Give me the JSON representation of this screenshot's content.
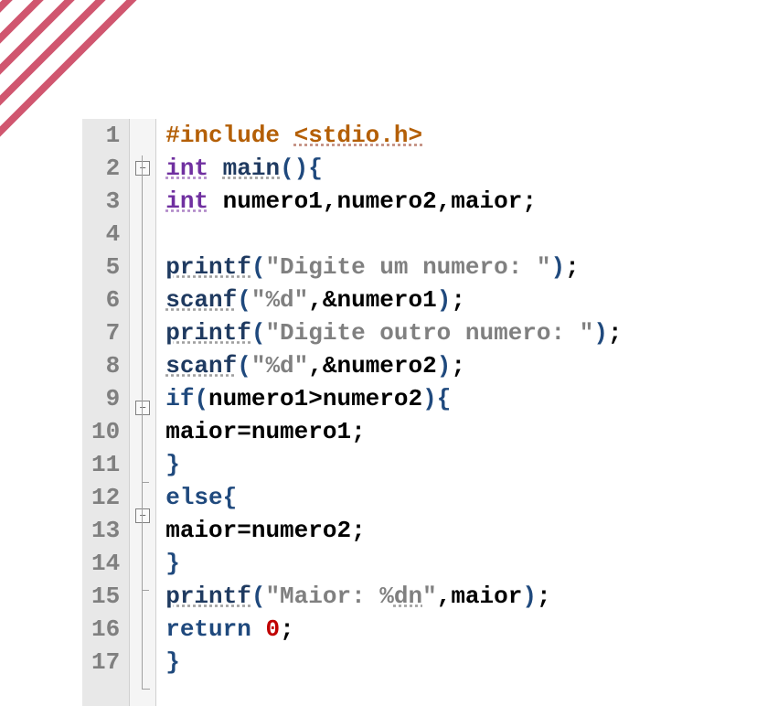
{
  "lines": [
    {
      "n": "1",
      "tokens": [
        [
          "tok-prep",
          "#include "
        ],
        [
          "tok-inc",
          "<stdio.h>"
        ]
      ]
    },
    {
      "n": "2",
      "tokens": [
        [
          "tok-type",
          "int"
        ],
        [
          "tok-punc",
          " "
        ],
        [
          "tok-fn",
          "main"
        ],
        [
          "tok-brace",
          "()"
        ],
        [
          "tok-brace",
          "{"
        ]
      ]
    },
    {
      "n": "3",
      "tokens": [
        [
          "tok-type",
          "int"
        ],
        [
          "tok-punc",
          " "
        ],
        [
          "tok-id",
          "numero1"
        ],
        [
          "tok-punc",
          ","
        ],
        [
          "tok-id",
          "numero2"
        ],
        [
          "tok-punc",
          ","
        ],
        [
          "tok-id",
          "maior"
        ],
        [
          "tok-punc",
          ";"
        ]
      ]
    },
    {
      "n": "4",
      "tokens": []
    },
    {
      "n": "5",
      "tokens": [
        [
          "tok-fn",
          "printf"
        ],
        [
          "tok-brace",
          "("
        ],
        [
          "tok-str",
          "\"Digite um numero: \""
        ],
        [
          "tok-brace",
          ")"
        ],
        [
          "tok-punc",
          ";"
        ]
      ]
    },
    {
      "n": "6",
      "tokens": [
        [
          "tok-fn",
          "scanf"
        ],
        [
          "tok-brace",
          "("
        ],
        [
          "tok-str",
          "\"%d\""
        ],
        [
          "tok-punc",
          ","
        ],
        [
          "tok-punc",
          "&"
        ],
        [
          "tok-id",
          "numero1"
        ],
        [
          "tok-brace",
          ")"
        ],
        [
          "tok-punc",
          ";"
        ]
      ]
    },
    {
      "n": "7",
      "tokens": [
        [
          "tok-fn",
          "printf"
        ],
        [
          "tok-brace",
          "("
        ],
        [
          "tok-str",
          "\"Digite outro numero: \""
        ],
        [
          "tok-brace",
          ")"
        ],
        [
          "tok-punc",
          ";"
        ]
      ]
    },
    {
      "n": "8",
      "tokens": [
        [
          "tok-fn",
          "scanf"
        ],
        [
          "tok-brace",
          "("
        ],
        [
          "tok-str",
          "\"%d\""
        ],
        [
          "tok-punc",
          ","
        ],
        [
          "tok-punc",
          "&"
        ],
        [
          "tok-id",
          "numero2"
        ],
        [
          "tok-brace",
          ")"
        ],
        [
          "tok-punc",
          ";"
        ]
      ]
    },
    {
      "n": "9",
      "tokens": [
        [
          "tok-kw",
          "if"
        ],
        [
          "tok-brace",
          "("
        ],
        [
          "tok-id",
          "numero1"
        ],
        [
          "tok-punc",
          ">"
        ],
        [
          "tok-id",
          "numero2"
        ],
        [
          "tok-brace",
          ")"
        ],
        [
          "tok-brace",
          "{"
        ]
      ]
    },
    {
      "n": "10",
      "tokens": [
        [
          "tok-id",
          "maior"
        ],
        [
          "tok-punc",
          "="
        ],
        [
          "tok-id",
          "numero1"
        ],
        [
          "tok-punc",
          ";"
        ]
      ]
    },
    {
      "n": "11",
      "tokens": [
        [
          "tok-brace",
          "}"
        ]
      ]
    },
    {
      "n": "12",
      "tokens": [
        [
          "tok-kw",
          "else"
        ],
        [
          "tok-brace",
          "{"
        ]
      ]
    },
    {
      "n": "13",
      "tokens": [
        [
          "tok-id",
          "maior"
        ],
        [
          "tok-punc",
          "="
        ],
        [
          "tok-id",
          "numero2"
        ],
        [
          "tok-punc",
          ";"
        ]
      ]
    },
    {
      "n": "14",
      "tokens": [
        [
          "tok-brace",
          "}"
        ]
      ]
    },
    {
      "n": "15",
      "tokens": [
        [
          "tok-fn",
          "printf"
        ],
        [
          "tok-brace",
          "("
        ],
        [
          "tok-str",
          "\"Maior: %"
        ],
        [
          "tok-str tok-strU",
          "dn"
        ],
        [
          "tok-str",
          "\""
        ],
        [
          "tok-punc",
          ","
        ],
        [
          "tok-id",
          "maior"
        ],
        [
          "tok-brace",
          ")"
        ],
        [
          "tok-punc",
          ";"
        ]
      ]
    },
    {
      "n": "16",
      "tokens": [
        [
          "tok-kw",
          "return"
        ],
        [
          "tok-punc",
          " "
        ],
        [
          "tok-num",
          "0"
        ],
        [
          "tok-punc",
          ";"
        ]
      ]
    },
    {
      "n": "17",
      "tokens": [
        [
          "tok-brace",
          "}"
        ]
      ]
    }
  ],
  "fold_markers": {
    "2": "box",
    "9": "box",
    "11": "tick",
    "12": "box",
    "14": "tick",
    "17": "L"
  },
  "fold_symbol": "–"
}
